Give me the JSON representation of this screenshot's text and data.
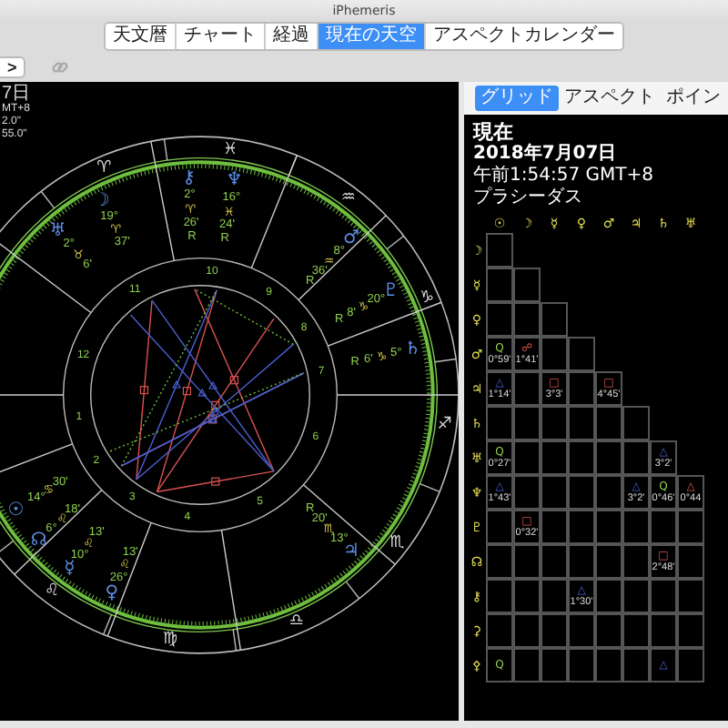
{
  "window": {
    "title": "iPhemeris"
  },
  "tabs": [
    {
      "label": "天文暦",
      "selected": false
    },
    {
      "label": "チャート",
      "selected": false
    },
    {
      "label": "経過",
      "selected": false
    },
    {
      "label": "現在の天空",
      "selected": true
    },
    {
      "label": "アスペクトカレンダー",
      "selected": false
    }
  ],
  "nav": {
    "forward": ">"
  },
  "chart": {
    "info": [
      "7日",
      "MT+8",
      "2.0\"",
      "55.0\""
    ],
    "signs": [
      "♈",
      "♓",
      "♒",
      "♑",
      "♐",
      "♏",
      "♎",
      "♍",
      "♌"
    ],
    "houses": [
      "1",
      "2",
      "3",
      "4",
      "5",
      "6",
      "7",
      "8",
      "9",
      "10",
      "11",
      "12"
    ],
    "placements": [
      {
        "glyph": "☽",
        "texts": [
          "19°",
          "♈",
          "37'"
        ]
      },
      {
        "glyph": "♅",
        "texts": [
          "2°",
          "♉",
          "6'"
        ]
      },
      {
        "glyph": "⚷",
        "texts": [
          "2°",
          "♈",
          "26'",
          "R"
        ]
      },
      {
        "glyph": "♆",
        "texts": [
          "16°",
          "♓",
          "24'",
          "R"
        ]
      },
      {
        "glyph": "♂",
        "texts": [
          "8°",
          "♒",
          "36'",
          "R"
        ]
      },
      {
        "glyph": "♇",
        "texts": [
          "20°",
          "♑",
          "8'",
          "R"
        ]
      },
      {
        "glyph": "♄",
        "texts": [
          "5°",
          "♑",
          "6'",
          "R"
        ]
      },
      {
        "glyph": "♃",
        "texts": [
          "13°",
          "♏",
          "20'",
          "R"
        ]
      },
      {
        "glyph": "☉",
        "texts": [
          "14°",
          "♋",
          "30'"
        ]
      },
      {
        "glyph": "☊",
        "texts": [
          "6°",
          "♌",
          "18'"
        ]
      },
      {
        "glyph": "☿",
        "texts": [
          "10°",
          "♌",
          "13'"
        ]
      },
      {
        "glyph": "♀",
        "texts": [
          "26°",
          "♌",
          "13'"
        ]
      }
    ]
  },
  "side_tabs": [
    {
      "label": "グリッド",
      "selected": true
    },
    {
      "label": "アスペクト",
      "selected": false
    },
    {
      "label": "ポイン",
      "selected": false
    }
  ],
  "grid": {
    "title": "現在",
    "date": "2018年7月07日",
    "time": "午前1:54:57 GMT+8",
    "house_system": "プラシーダス",
    "columns": [
      "☉",
      "☽",
      "☿",
      "♀",
      "♂",
      "♃",
      "♄",
      "♅"
    ],
    "rows": [
      {
        "glyph": "☽",
        "cells": [
          {
            "kind": "none"
          }
        ]
      },
      {
        "glyph": "☿",
        "cells": [
          {
            "kind": "none"
          },
          {
            "kind": "none"
          }
        ]
      },
      {
        "glyph": "♀",
        "cells": [
          {
            "kind": "none"
          },
          {
            "kind": "none"
          },
          {
            "kind": "none"
          }
        ]
      },
      {
        "glyph": "♂",
        "cells": [
          {
            "kind": "quintile",
            "symbol": "Q",
            "orb": "0°59'"
          },
          {
            "kind": "opposition",
            "symbol": "☍",
            "orb": "1°41'"
          },
          {
            "kind": "none"
          },
          {
            "kind": "none"
          }
        ]
      },
      {
        "glyph": "♃",
        "cells": [
          {
            "kind": "trine",
            "symbol": "△",
            "orb": "1°14'"
          },
          {
            "kind": "none"
          },
          {
            "kind": "square",
            "symbol": "□",
            "orb": "3°3'"
          },
          {
            "kind": "none"
          },
          {
            "kind": "square",
            "symbol": "□",
            "orb": "4°45'"
          }
        ]
      },
      {
        "glyph": "♄",
        "cells": [
          {
            "kind": "none"
          },
          {
            "kind": "none"
          },
          {
            "kind": "none"
          },
          {
            "kind": "none"
          },
          {
            "kind": "none"
          },
          {
            "kind": "none"
          }
        ]
      },
      {
        "glyph": "♅",
        "cells": [
          {
            "kind": "quintile",
            "symbol": "Q",
            "orb": "0°27'"
          },
          {
            "kind": "none"
          },
          {
            "kind": "none"
          },
          {
            "kind": "none"
          },
          {
            "kind": "none"
          },
          {
            "kind": "none"
          },
          {
            "kind": "trine",
            "symbol": "△",
            "orb": "3°2'"
          }
        ]
      },
      {
        "glyph": "♆",
        "cells": [
          {
            "kind": "trine",
            "symbol": "△",
            "orb": "1°43'"
          },
          {
            "kind": "none"
          },
          {
            "kind": "none"
          },
          {
            "kind": "none"
          },
          {
            "kind": "none"
          },
          {
            "kind": "trine",
            "symbol": "△",
            "orb": "3°2'"
          },
          {
            "kind": "quintile",
            "symbol": "Q",
            "orb": "0°46'"
          },
          {
            "kind": "minor",
            "symbol": "△",
            "orb": "0°44"
          }
        ]
      },
      {
        "glyph": "♇",
        "cells": [
          {
            "kind": "none"
          },
          {
            "kind": "square",
            "symbol": "□",
            "orb": "0°32'"
          },
          {
            "kind": "none"
          },
          {
            "kind": "none"
          },
          {
            "kind": "none"
          },
          {
            "kind": "none"
          },
          {
            "kind": "none"
          },
          {
            "kind": "none"
          }
        ]
      },
      {
        "glyph": "☊",
        "cells": [
          {
            "kind": "none"
          },
          {
            "kind": "none"
          },
          {
            "kind": "none"
          },
          {
            "kind": "none"
          },
          {
            "kind": "none"
          },
          {
            "kind": "none"
          },
          {
            "kind": "square",
            "symbol": "□",
            "orb": "2°48'"
          },
          {
            "kind": "none"
          }
        ]
      },
      {
        "glyph": "⚷",
        "cells": [
          {
            "kind": "none"
          },
          {
            "kind": "none"
          },
          {
            "kind": "none"
          },
          {
            "kind": "trine",
            "symbol": "△",
            "orb": "1°30'"
          },
          {
            "kind": "none"
          },
          {
            "kind": "none"
          },
          {
            "kind": "none"
          },
          {
            "kind": "none"
          }
        ]
      },
      {
        "glyph": "⚳",
        "cells": [
          {
            "kind": "none"
          },
          {
            "kind": "none"
          },
          {
            "kind": "none"
          },
          {
            "kind": "none"
          },
          {
            "kind": "none"
          },
          {
            "kind": "none"
          },
          {
            "kind": "none"
          },
          {
            "kind": "none"
          }
        ]
      },
      {
        "glyph": "⚴",
        "cells": [
          {
            "kind": "quintile",
            "symbol": "Q"
          },
          {
            "kind": "none"
          },
          {
            "kind": "none"
          },
          {
            "kind": "none"
          },
          {
            "kind": "none"
          },
          {
            "kind": "none"
          },
          {
            "kind": "trine",
            "symbol": "△"
          },
          {
            "kind": "none"
          }
        ]
      }
    ]
  }
}
